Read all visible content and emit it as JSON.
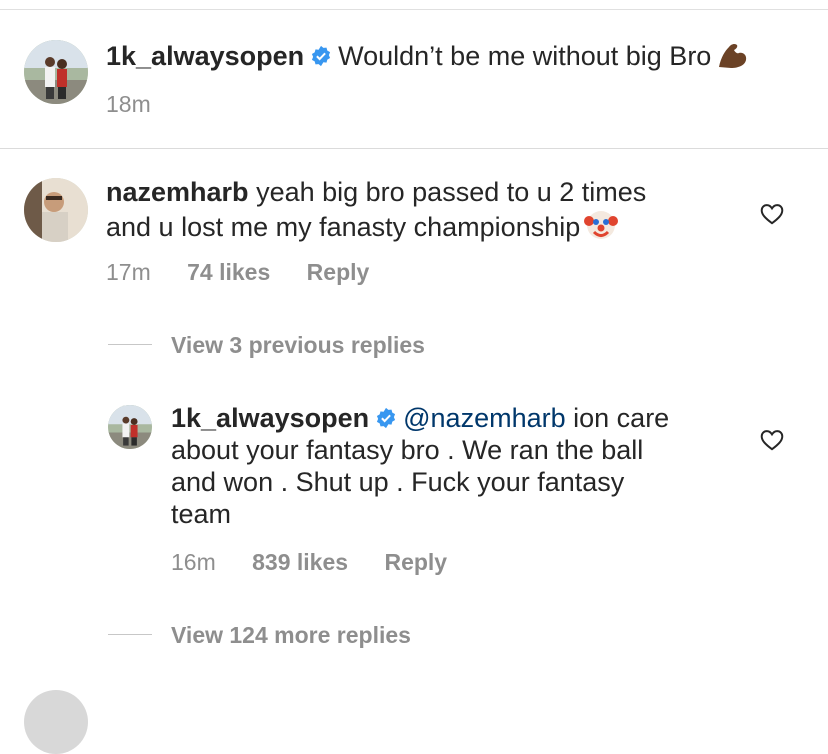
{
  "caption": {
    "username": "1k_alwaysopen",
    "text": "Wouldn’t be me without big Bro",
    "emoji": "flexed-biceps",
    "time": "18m"
  },
  "comments": [
    {
      "username": "nazemharb",
      "line1": "yeah big bro passed to u 2 times",
      "line2": "and u lost me my fanasty championship",
      "emoji": "clown-face",
      "time": "17m",
      "likes": "74 likes",
      "reply_label": "Reply"
    }
  ],
  "view_previous": "View 3 previous replies",
  "reply": {
    "username": "1k_alwaysopen",
    "mention": "@nazemharb",
    "line1_rest": "ion care",
    "line2": "about your fantasy bro . We ran the ball",
    "line3": "and won . Shut up . Fuck your fantasy",
    "line4": "team",
    "time": "16m",
    "likes": "839 likes",
    "reply_label": "Reply"
  },
  "view_more": "View 124 more replies",
  "colors": {
    "verified": "#3897f0",
    "mention": "#00376b",
    "secondary": "#8e8e8e",
    "primary": "#262626"
  }
}
